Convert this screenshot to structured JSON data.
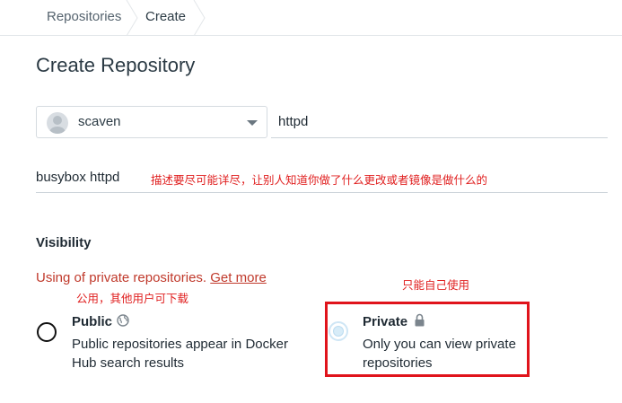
{
  "breadcrumb": {
    "items": [
      "Repositories",
      "Create"
    ]
  },
  "page": {
    "title": "Create Repository"
  },
  "form": {
    "namespace": "scaven",
    "repo_name": "httpd",
    "description": "busybox httpd"
  },
  "visibility": {
    "heading": "Visibility",
    "private_note": "Using of private repositories.",
    "get_more": "Get more",
    "public": {
      "title": "Public",
      "icon": "globe-icon",
      "description": "Public repositories appear in Docker Hub search results"
    },
    "private": {
      "title": "Private",
      "icon": "lock-icon",
      "description": "Only you can view private repositories",
      "selected": true
    }
  },
  "annotations": {
    "description": "描述要尽可能详尽，让别人知道你做了什么更改或者镜像是做什么的",
    "public": "公用，其他用户可下载",
    "private": "只能自己使用",
    "highlight_color": "#e0141b"
  },
  "colors": {
    "annotation": "#e02020",
    "note": "#c0392b"
  }
}
